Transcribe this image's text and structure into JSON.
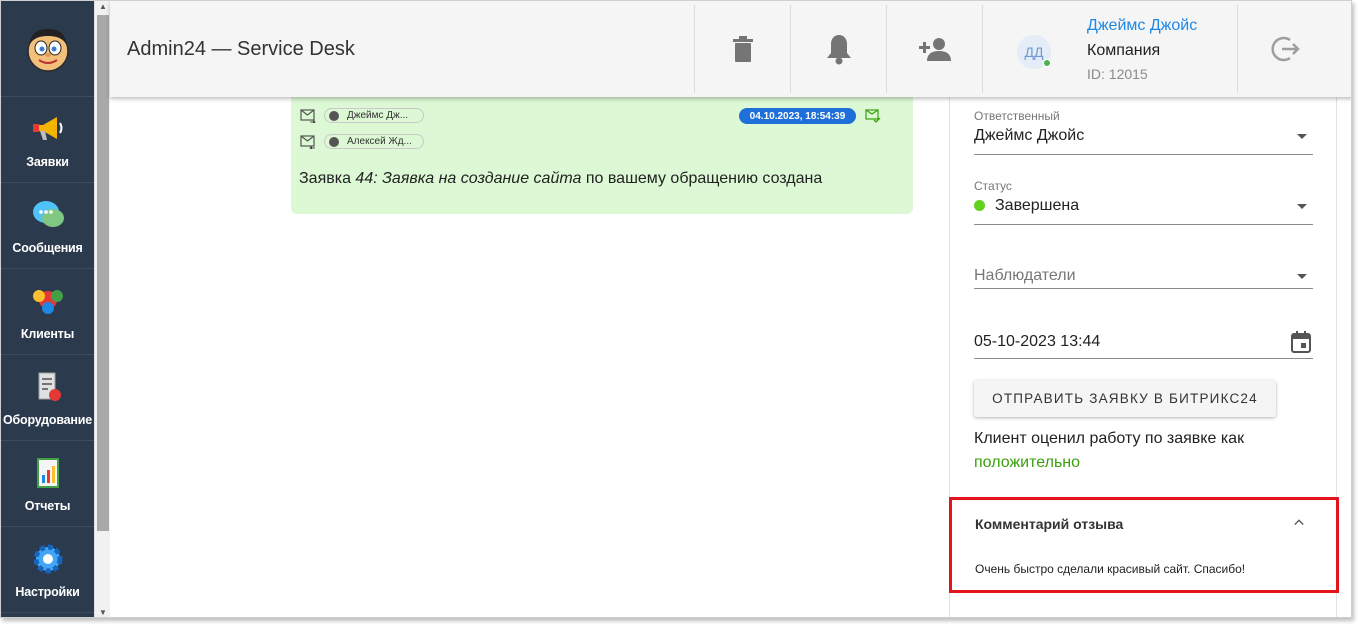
{
  "header": {
    "title": "Admin24 — Service Desk",
    "user": {
      "initials": "ДД",
      "name": "Джеймс Джойс",
      "company": "Компания",
      "id_label": "ID: 12015"
    }
  },
  "sidebar": {
    "items": [
      {
        "label": "Заявки",
        "icon": "megaphone-icon"
      },
      {
        "label": "Сообщения",
        "icon": "chat-icon"
      },
      {
        "label": "Клиенты",
        "icon": "clients-icon"
      },
      {
        "label": "Оборудование",
        "icon": "equipment-icon"
      },
      {
        "label": "Отчеты",
        "icon": "report-icon"
      },
      {
        "label": "Настройки",
        "icon": "gear-icon"
      }
    ]
  },
  "message": {
    "from": "Джеймс Дж...",
    "to": "Алексей Жд...",
    "datetime": "04.10.2023, 18:54:39",
    "text_prefix": "Заявка ",
    "text_italic": "44: Заявка на создание сайта",
    "text_suffix": " по вашему обращению создана"
  },
  "panel": {
    "responsible": {
      "label": "Ответственный",
      "value": "Джеймс Джойс"
    },
    "status": {
      "label": "Статус",
      "value": "Завершена",
      "color": "#61d01f"
    },
    "watchers": {
      "placeholder": "Наблюдатели"
    },
    "date": {
      "value": "05-10-2023 13:44"
    },
    "bitrix_button": "ОТПРАВИТЬ ЗАЯВКУ В БИТРИКС24",
    "rating_text": "Клиент оценил работу по заявке как",
    "rating_value": "положительно",
    "review": {
      "title": "Комментарий отзыва",
      "text": "Очень быстро сделали красивый сайт. Спасибо!"
    }
  }
}
